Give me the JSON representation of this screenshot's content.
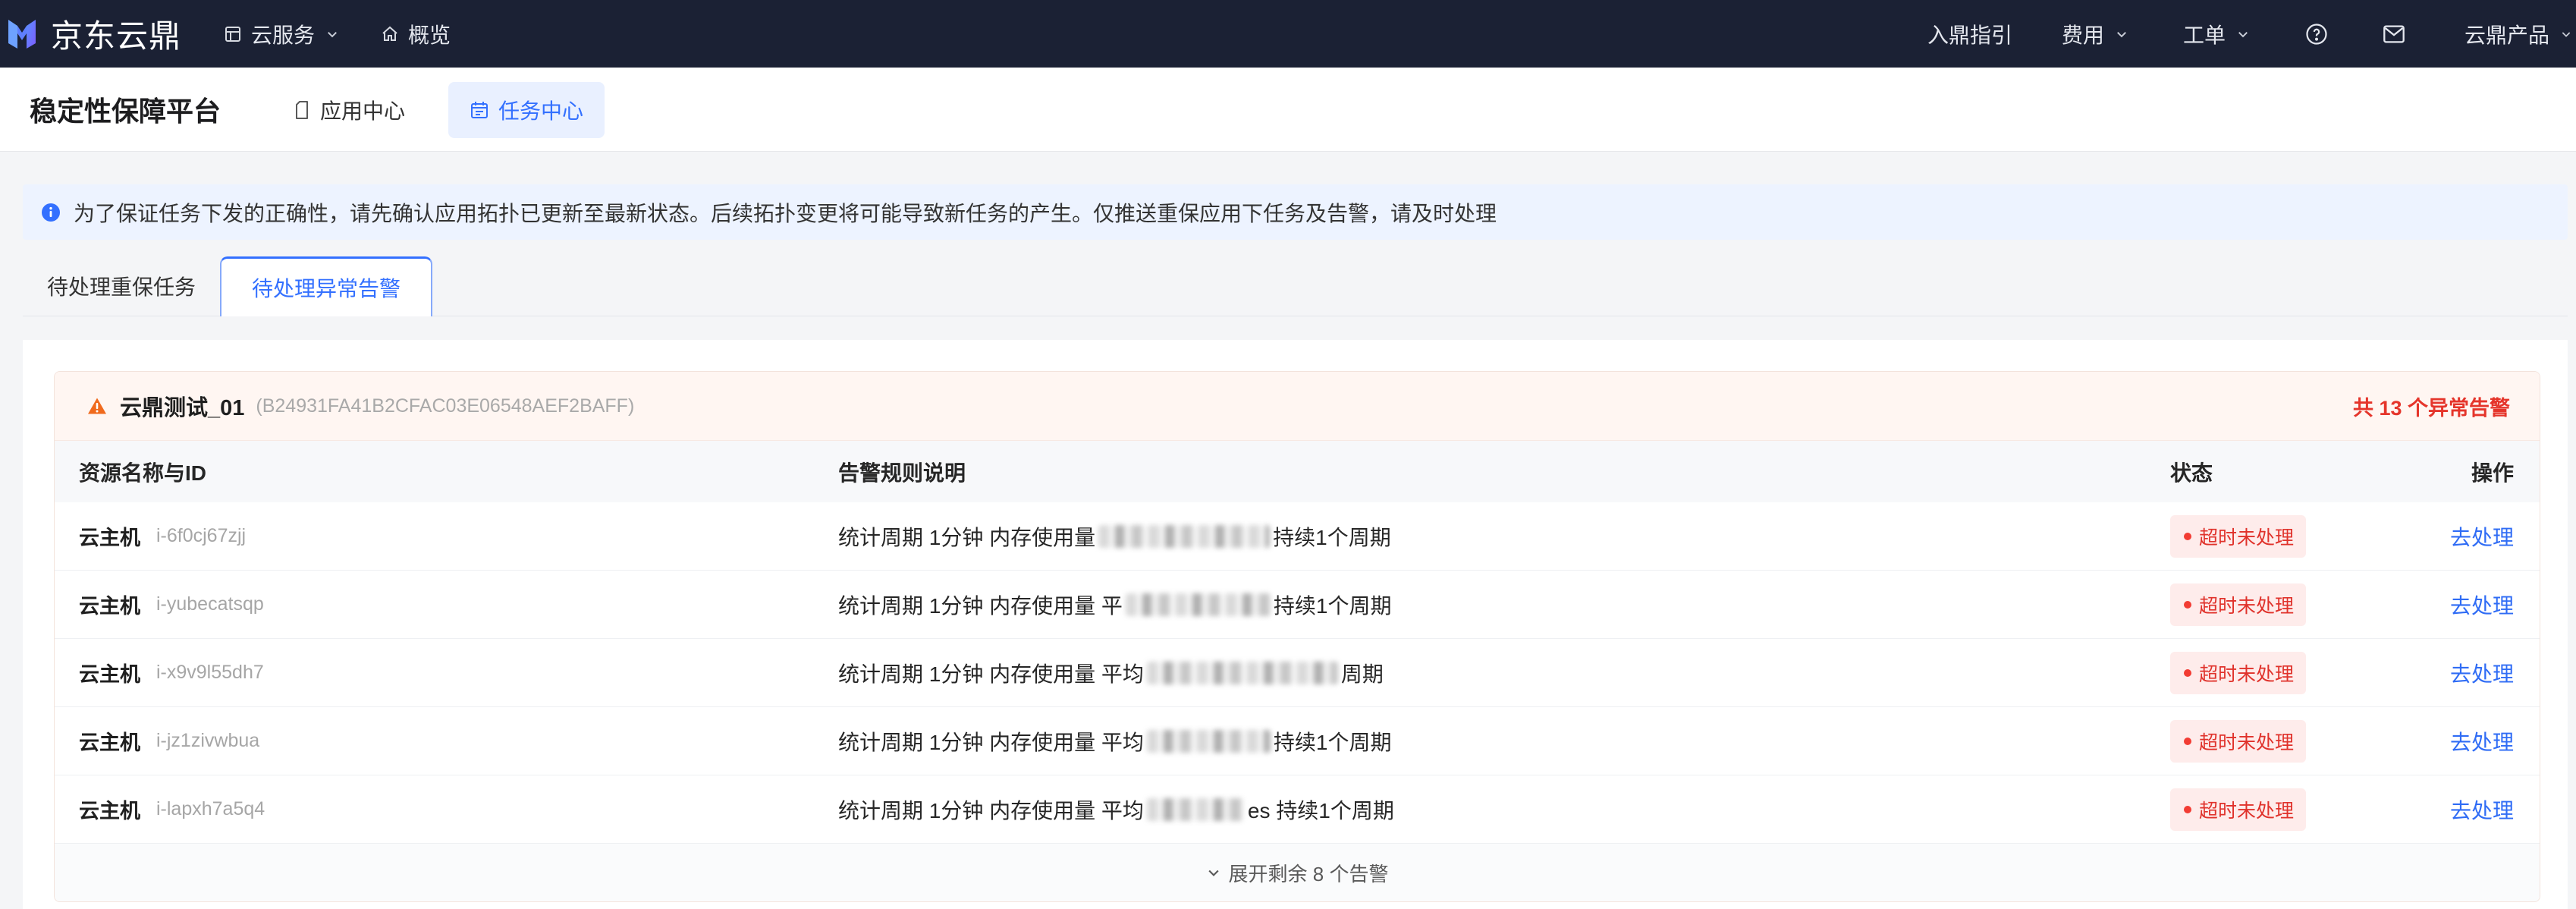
{
  "colors": {
    "nav_bg": "#1b2134",
    "primary": "#3370ff",
    "danger": "#e5352b",
    "notice_bg": "#edf3ff",
    "group_header_bg": "#fff6f2"
  },
  "nav": {
    "brand": "京东云鼎",
    "menu": [
      {
        "label": "云服务",
        "icon": "grid-icon",
        "has_dropdown": true
      },
      {
        "label": "概览",
        "icon": "home-icon",
        "has_dropdown": false
      }
    ],
    "right": [
      {
        "label": "入鼎指引",
        "has_dropdown": false
      },
      {
        "label": "费用",
        "has_dropdown": true
      },
      {
        "label": "工单",
        "has_dropdown": true
      }
    ],
    "icon_buttons": [
      "question-circle-icon",
      "mail-icon"
    ],
    "product_menu": {
      "label": "云鼎产品",
      "has_dropdown": true
    }
  },
  "subheader": {
    "title": "稳定性保障平台",
    "tabs": [
      {
        "label": "应用中心",
        "icon": "document-icon",
        "active": false
      },
      {
        "label": "任务中心",
        "icon": "calendar-icon",
        "active": true
      }
    ]
  },
  "notice": {
    "icon": "info-icon",
    "text": "为了保证任务下发的正确性，请先确认应用拓扑已更新至最新状态。后续拓扑变更将可能导致新任务的产生。仅推送重保应用下任务及告警，请及时处理"
  },
  "task_tabs": [
    {
      "label": "待处理重保任务",
      "active": false
    },
    {
      "label": "待处理异常告警",
      "active": true
    }
  ],
  "alert_group": {
    "icon": "warning-icon",
    "name": "云鼎测试_01",
    "id": "(B24931FA41B2CFAC03E06548AEF2BAFF)",
    "summary": "共 13 个异常告警",
    "columns": [
      "资源名称与ID",
      "告警规则说明",
      "状态",
      "操作"
    ],
    "rows": [
      {
        "type": "云主机",
        "id": "i-6f0cj67zjj",
        "rule_prefix": "统计周期 1分钟 内存使用量",
        "rule_suffix": "持续1个周期",
        "status": "超时未处理",
        "action": "去处理"
      },
      {
        "type": "云主机",
        "id": "i-yubecatsqp",
        "rule_prefix": "统计周期 1分钟 内存使用量 平",
        "rule_suffix": "持续1个周期",
        "status": "超时未处理",
        "action": "去处理"
      },
      {
        "type": "云主机",
        "id": "i-x9v9l55dh7",
        "rule_prefix": "统计周期 1分钟 内存使用量 平均",
        "rule_suffix": "周期",
        "status": "超时未处理",
        "action": "去处理"
      },
      {
        "type": "云主机",
        "id": "i-jz1zivwbua",
        "rule_prefix": "统计周期 1分钟 内存使用量 平均",
        "rule_suffix": "持续1个周期",
        "status": "超时未处理",
        "action": "去处理"
      },
      {
        "type": "云主机",
        "id": "i-lapxh7a5q4",
        "rule_prefix": "统计周期 1分钟 内存使用量 平均",
        "rule_suffix": "es 持续1个周期",
        "status": "超时未处理",
        "action": "去处理"
      }
    ],
    "expand_label": "展开剩余 8 个告警"
  }
}
